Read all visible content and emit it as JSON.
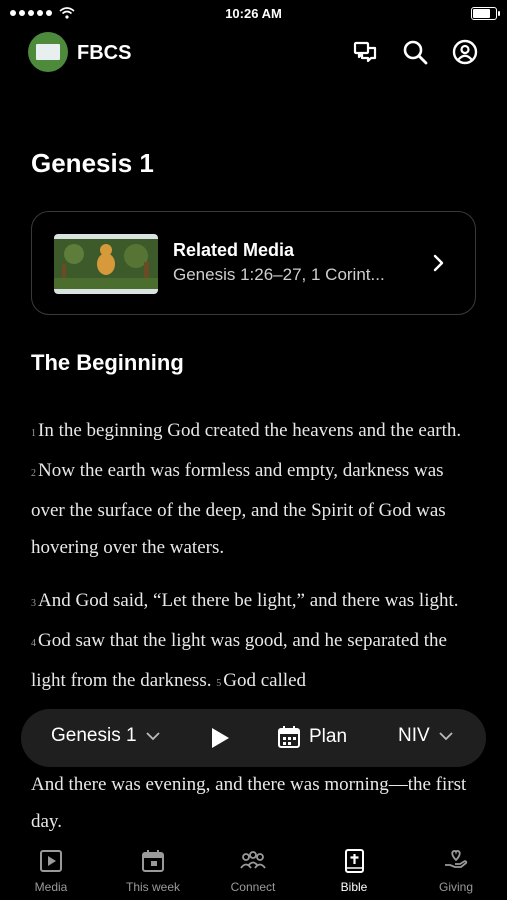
{
  "status_bar": {
    "time": "10:26 AM",
    "battery_level": 0.85
  },
  "header": {
    "brand": "FBCS"
  },
  "chapter_title": "Genesis 1",
  "related_media": {
    "title": "Related Media",
    "subtitle": "Genesis 1:26–27, 1 Corint..."
  },
  "section_heading": "The Beginning",
  "verses": [
    {
      "number": "1",
      "text": "In the beginning God created the heavens and the earth."
    },
    {
      "number": "2",
      "text": "Now the earth was formless and empty, darkness was over the surface of the deep, and the Spirit of God was hovering over the waters."
    },
    {
      "number": "3",
      "text": "And God said, “Let there be light,” and there was light."
    },
    {
      "number": "4",
      "text": "God saw that the light was good, and he separated the light from the darkness."
    },
    {
      "number": "5",
      "text": "God called"
    }
  ],
  "continued_text": "And there was evening, and there was morning—the first day.",
  "player": {
    "chapter": "Genesis 1",
    "plan_label": "Plan",
    "translation": "NIV"
  },
  "tabs": [
    {
      "label": "Media",
      "icon": "play-square-icon",
      "active": false
    },
    {
      "label": "This week",
      "icon": "calendar-icon",
      "active": false
    },
    {
      "label": "Connect",
      "icon": "people-icon",
      "active": false
    },
    {
      "label": "Bible",
      "icon": "bible-icon",
      "active": true
    },
    {
      "label": "Giving",
      "icon": "giving-hand-icon",
      "active": false
    }
  ]
}
